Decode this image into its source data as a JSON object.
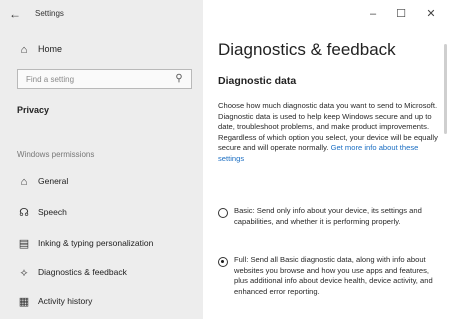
{
  "window": {
    "title": "Settings",
    "back_icon": "←",
    "controls": {
      "minimize": "–",
      "maximize": "☐",
      "close": "✕"
    }
  },
  "sidebar": {
    "home": {
      "label": "Home",
      "icon": "⌂"
    },
    "search": {
      "placeholder": "Find a setting",
      "icon": "⚲"
    },
    "section_privacy": "Privacy",
    "section_windows_permissions": "Windows permissions",
    "items": [
      {
        "label": "General",
        "icon": "⌂"
      },
      {
        "label": "Speech",
        "icon": "☊"
      },
      {
        "label": "Inking & typing personalization",
        "icon": "▤"
      },
      {
        "label": "Diagnostics & feedback",
        "icon": "⟡"
      },
      {
        "label": "Activity history",
        "icon": "▦"
      }
    ]
  },
  "main": {
    "title": "Diagnostics & feedback",
    "subheading": "Diagnostic data",
    "description": "Choose how much diagnostic data you want to send to Microsoft. Diagnostic data is used to help keep Windows secure and up to date, troubleshoot problems, and make product improvements. Regardless of which option you select, your device will be equally secure and will operate normally.",
    "link": "Get more info about these settings",
    "options": [
      {
        "label": "Basic: Send only info about your device, its settings and capabilities, and whether it is performing properly.",
        "selected": false
      },
      {
        "label": "Full: Send all Basic diagnostic data, along with info about websites you browse and how you use apps and features, plus additional info about device health, device activity, and enhanced error reporting.",
        "selected": true
      }
    ]
  }
}
